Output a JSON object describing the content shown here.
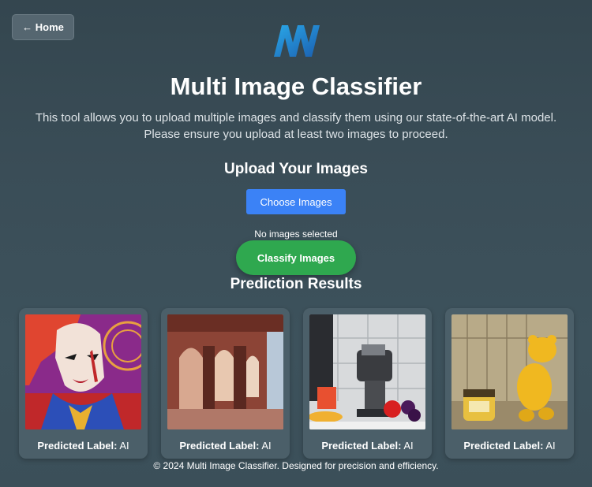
{
  "nav": {
    "home_label": "← Home"
  },
  "header": {
    "title": "Multi Image Classifier",
    "description": "This tool allows you to upload multiple images and classify them using our state-of-the-art AI model. Please ensure you upload at least two images to proceed."
  },
  "upload": {
    "title": "Upload Your Images",
    "choose_label": "Choose Images",
    "status": "No images selected",
    "classify_label": "Classify Images"
  },
  "results": {
    "title": "Prediction Results",
    "items": [
      {
        "label_prefix": "Predicted Label:",
        "label_value": "AI",
        "image": "comic-woman-portrait"
      },
      {
        "label_prefix": "Predicted Label:",
        "label_value": "AI",
        "image": "red-sandstone-arches"
      },
      {
        "label_prefix": "Predicted Label:",
        "label_value": "AI",
        "image": "juicer-with-fruits"
      },
      {
        "label_prefix": "Predicted Label:",
        "label_value": "AI",
        "image": "cartoon-bear-honey-pot"
      }
    ]
  },
  "footer": {
    "text": "© 2024 Multi Image Classifier. Designed for precision and efficiency."
  },
  "colors": {
    "background": "#3a4d57",
    "choose_button": "#3b82f6",
    "classify_button": "#2fa84f",
    "card": "#4b5f69"
  }
}
